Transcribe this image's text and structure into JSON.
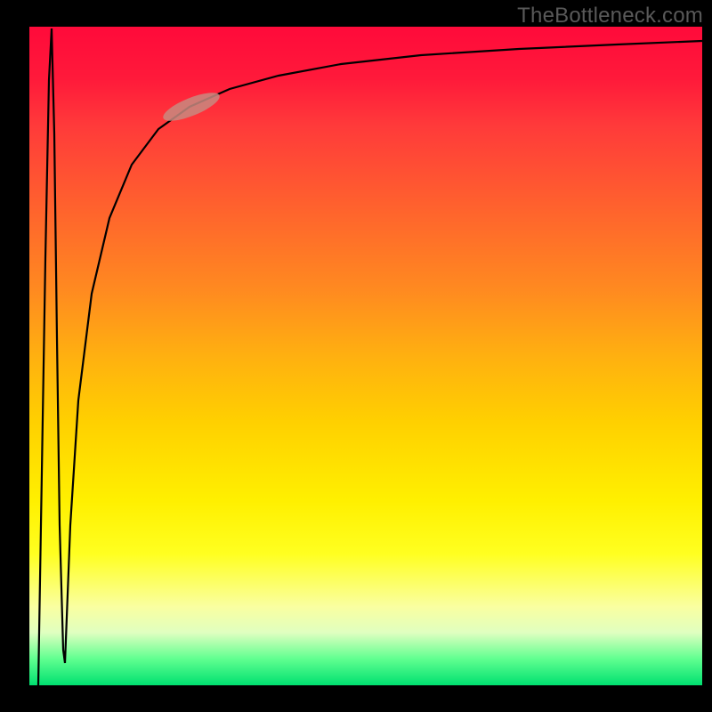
{
  "watermark": "TheBottleneck.com",
  "chart_data": {
    "type": "line",
    "title": "",
    "xlabel": "",
    "ylabel": "",
    "xlim": [
      0,
      100
    ],
    "ylim": [
      0,
      100
    ],
    "background_gradient": {
      "orientation": "vertical",
      "stops": [
        {
          "pos": 0.0,
          "color": "#ff0a3a"
        },
        {
          "pos": 0.5,
          "color": "#ffb010"
        },
        {
          "pos": 0.8,
          "color": "#ffff20"
        },
        {
          "pos": 1.0,
          "color": "#00e070"
        }
      ],
      "meaning": "bottleneck-severity (top=red=high, bottom=green=low)"
    },
    "series": [
      {
        "name": "bottleneck-curve",
        "path_description": "starts near (2,0), spikes to ~(3,100), falls back to ~(5,0), then rises logarithmically to ~(100,97)",
        "x": [
          2,
          2.5,
          3,
          3.5,
          4,
          5,
          6,
          8,
          10,
          14,
          18,
          22,
          28,
          36,
          50,
          70,
          100
        ],
        "y": [
          0,
          60,
          100,
          55,
          20,
          5,
          30,
          55,
          68,
          78,
          83,
          86,
          89,
          91,
          93,
          95,
          97
        ]
      }
    ],
    "highlight": {
      "description": "salmon oval band on rising curve",
      "x_range": [
        20,
        27
      ],
      "y_range": [
        85,
        89
      ]
    }
  }
}
